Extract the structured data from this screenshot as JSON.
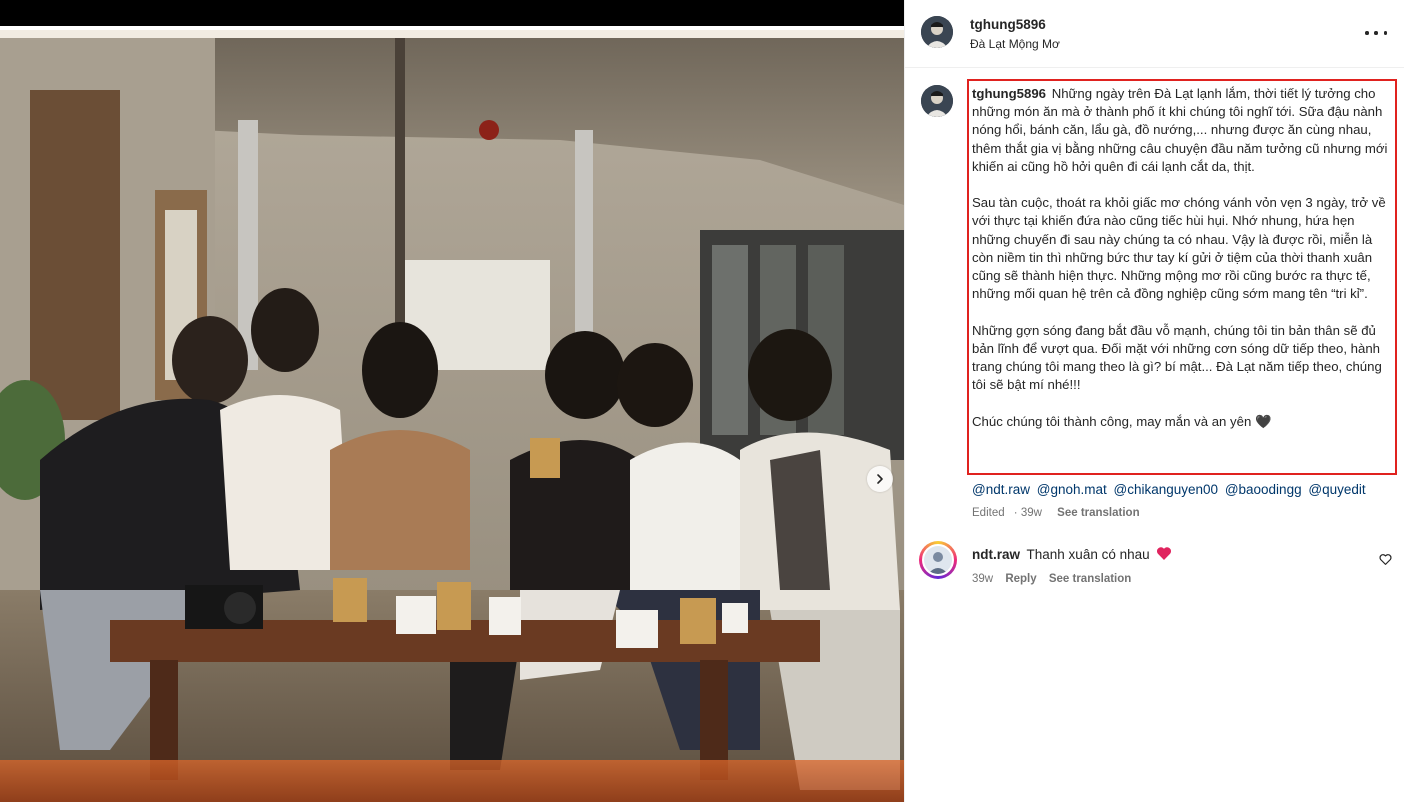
{
  "post": {
    "username": "tghung5896",
    "location": "Đà Lạt Mộng Mơ"
  },
  "caption": {
    "username": "tghung5896",
    "paragraphs": [
      "Những ngày trên Đà Lạt lạnh lắm, thời tiết lý tưởng cho những món ăn mà ở thành phố ít khi chúng tôi nghĩ tới. Sữa đậu nành nóng hổi, bánh căn, lẩu gà, đồ nướng,... nhưng được ăn cùng nhau, thêm thắt gia vị bằng những câu chuyện đầu năm tưởng cũ nhưng mới khiến ai cũng hồ hởi quên đi cái lạnh cắt da, thịt.",
      "Sau tàn cuộc, thoát ra khỏi giấc mơ chóng vánh vỏn vẹn 3 ngày, trở về với thực tại khiến đứa nào cũng tiếc hùi hụi. Nhớ nhung, hứa hẹn những chuyến đi sau này chúng ta có nhau. Vậy là được rồi, miễn là còn niềm tin thì những bức thư tay kí gửi ở tiệm của thời thanh xuân cũng sẽ thành hiện thực. Những mộng mơ rồi cũng bước ra thực tế, những mối quan hệ trên cả đồng nghiệp cũng sớm mang tên “tri kỉ”.",
      "Những gợn sóng đang bắt đầu vỗ mạnh, chúng tôi tin bản thân sẽ đủ bản lĩnh để vượt qua. Đối mặt với những cơn sóng dữ tiếp theo, hành trang chúng tôi mang theo là gì? bí mật... Đà Lạt năm tiếp theo, chúng tôi sẽ bật mí nhé!!!",
      "Chúc chúng tôi thành công, may mắn và an yên 🖤"
    ],
    "mentions": [
      "@ndt.raw",
      "@gnoh.mat",
      "@chikanguyen00",
      "@baoodingg",
      "@quyedit"
    ],
    "meta": {
      "status": "Edited",
      "age": "39w",
      "see_translation": "See translation"
    }
  },
  "comment": {
    "username": "ndt.raw",
    "text": "Thanh xuân có nhau",
    "meta": {
      "age": "39w",
      "reply": "Reply",
      "see_translation": "See translation"
    }
  },
  "icons": {
    "more": "more-horizontal-icon",
    "next": "chevron-right-icon",
    "like": "heart-outline-icon",
    "emoji": "red-heart-emoji"
  },
  "colors": {
    "highlight_box": "#e0221f",
    "mention": "#00376b",
    "muted": "#737373",
    "heart": "#e0245e"
  }
}
